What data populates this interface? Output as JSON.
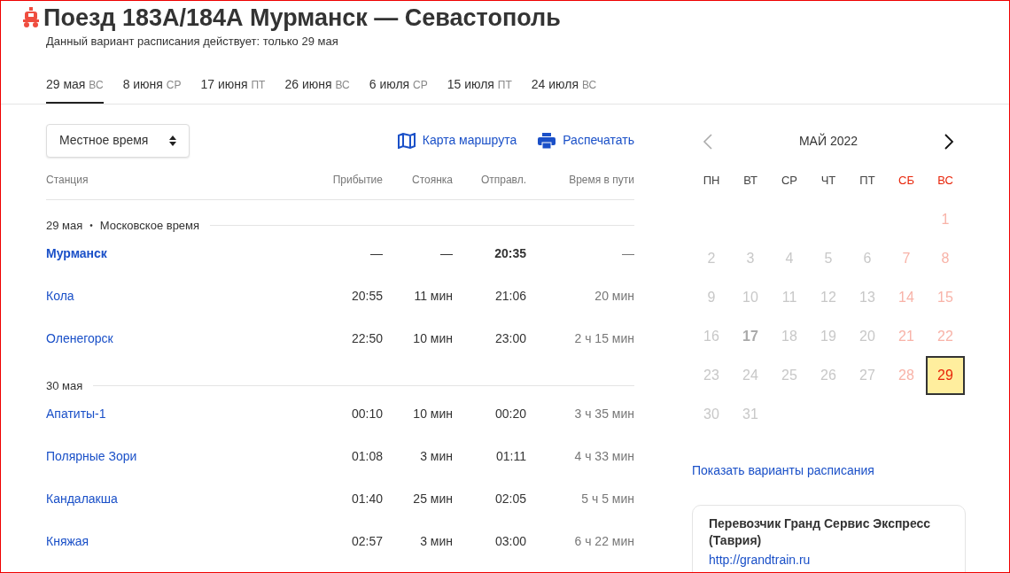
{
  "title": "Поезд 183А/184А Мурманск — Севастополь",
  "subtitle": "Данный вариант расписания действует: только 29 мая",
  "tabs": [
    {
      "date": "29 мая",
      "weekday": "ВС",
      "selected": true
    },
    {
      "date": "8 июня",
      "weekday": "СР",
      "selected": false
    },
    {
      "date": "17 июня",
      "weekday": "ПТ",
      "selected": false
    },
    {
      "date": "26 июня",
      "weekday": "ВС",
      "selected": false
    },
    {
      "date": "6 июля",
      "weekday": "СР",
      "selected": false
    },
    {
      "date": "15 июля",
      "weekday": "ПТ",
      "selected": false
    },
    {
      "date": "24 июля",
      "weekday": "ВС",
      "selected": false
    }
  ],
  "time_select": {
    "value": "Местное время"
  },
  "links": [
    {
      "kind": "map",
      "label": "Карта маршрута"
    },
    {
      "kind": "print",
      "label": "Распечатать"
    }
  ],
  "table": {
    "columns": [
      "Станция",
      "Прибытие",
      "Стоянка",
      "Отправл.",
      "Время в пути"
    ],
    "rows": [
      {
        "kind": "date",
        "date": "29 мая",
        "separator": "•",
        "note": "Московское время"
      },
      {
        "kind": "station",
        "station": "Мурманск",
        "origin": true,
        "arrival": "—",
        "stop": "—",
        "departure": "20:35",
        "travel": "—"
      },
      {
        "kind": "station",
        "station": "Кола",
        "origin": false,
        "arrival": "20:55",
        "stop": "11 мин",
        "departure": "21:06",
        "travel": "20 мин"
      },
      {
        "kind": "station",
        "station": "Оленегорск",
        "origin": false,
        "arrival": "22:50",
        "stop": "10 мин",
        "departure": "23:00",
        "travel": "2 ч 15 мин"
      },
      {
        "kind": "date",
        "date": "30 мая"
      },
      {
        "kind": "station",
        "station": "Апатиты-1",
        "origin": false,
        "arrival": "00:10",
        "stop": "10 мин",
        "departure": "00:20",
        "travel": "3 ч 35 мин"
      },
      {
        "kind": "station",
        "station": "Полярные Зори",
        "origin": false,
        "arrival": "01:08",
        "stop": "3 мин",
        "departure": "01:11",
        "travel": "4 ч 33 мин"
      },
      {
        "kind": "station",
        "station": "Кандалакша",
        "origin": false,
        "arrival": "01:40",
        "stop": "25 мин",
        "departure": "02:05",
        "travel": "5 ч 5 мин"
      },
      {
        "kind": "station",
        "station": "Княжая",
        "origin": false,
        "arrival": "02:57",
        "stop": "3 мин",
        "departure": "03:00",
        "travel": "6 ч 22 мин"
      }
    ]
  },
  "calendar": {
    "month": "МАЙ 2022",
    "prev_disabled": true,
    "weekdays": [
      {
        "label": "ПН",
        "weekend": false
      },
      {
        "label": "ВТ",
        "weekend": false
      },
      {
        "label": "СР",
        "weekend": false
      },
      {
        "label": "ЧТ",
        "weekend": false
      },
      {
        "label": "ПТ",
        "weekend": false
      },
      {
        "label": "СБ",
        "weekend": true
      },
      {
        "label": "ВС",
        "weekend": true
      }
    ],
    "days": [
      {
        "day": "1",
        "weekend": true,
        "bold": false,
        "selected": false
      },
      {
        "day": "2",
        "weekend": false,
        "bold": false,
        "selected": false
      },
      {
        "day": "3",
        "weekend": false,
        "bold": false,
        "selected": false
      },
      {
        "day": "4",
        "weekend": false,
        "bold": false,
        "selected": false
      },
      {
        "day": "5",
        "weekend": false,
        "bold": false,
        "selected": false
      },
      {
        "day": "6",
        "weekend": false,
        "bold": false,
        "selected": false
      },
      {
        "day": "7",
        "weekend": true,
        "bold": false,
        "selected": false
      },
      {
        "day": "8",
        "weekend": true,
        "bold": false,
        "selected": false
      },
      {
        "day": "9",
        "weekend": false,
        "bold": false,
        "selected": false
      },
      {
        "day": "10",
        "weekend": false,
        "bold": false,
        "selected": false
      },
      {
        "day": "11",
        "weekend": false,
        "bold": false,
        "selected": false
      },
      {
        "day": "12",
        "weekend": false,
        "bold": false,
        "selected": false
      },
      {
        "day": "13",
        "weekend": false,
        "bold": false,
        "selected": false
      },
      {
        "day": "14",
        "weekend": true,
        "bold": false,
        "selected": false
      },
      {
        "day": "15",
        "weekend": true,
        "bold": false,
        "selected": false
      },
      {
        "day": "16",
        "weekend": false,
        "bold": false,
        "selected": false
      },
      {
        "day": "17",
        "weekend": false,
        "bold": true,
        "selected": false
      },
      {
        "day": "18",
        "weekend": false,
        "bold": false,
        "selected": false
      },
      {
        "day": "19",
        "weekend": false,
        "bold": false,
        "selected": false
      },
      {
        "day": "20",
        "weekend": false,
        "bold": false,
        "selected": false
      },
      {
        "day": "21",
        "weekend": true,
        "bold": false,
        "selected": false
      },
      {
        "day": "22",
        "weekend": true,
        "bold": false,
        "selected": false
      },
      {
        "day": "23",
        "weekend": false,
        "bold": false,
        "selected": false
      },
      {
        "day": "24",
        "weekend": false,
        "bold": false,
        "selected": false
      },
      {
        "day": "25",
        "weekend": false,
        "bold": false,
        "selected": false
      },
      {
        "day": "26",
        "weekend": false,
        "bold": false,
        "selected": false
      },
      {
        "day": "27",
        "weekend": false,
        "bold": false,
        "selected": false
      },
      {
        "day": "28",
        "weekend": true,
        "bold": false,
        "selected": false
      },
      {
        "day": "29",
        "weekend": true,
        "bold": false,
        "selected": true
      },
      {
        "day": "30",
        "weekend": false,
        "bold": false,
        "selected": false
      },
      {
        "day": "31",
        "weekend": false,
        "bold": false,
        "selected": false
      }
    ]
  },
  "variants_link": "Показать варианты расписания",
  "carrier": {
    "name": "Перевозчик Гранд Сервис Экспресс (Таврия)",
    "url": "http://grandtrain.ru"
  }
}
